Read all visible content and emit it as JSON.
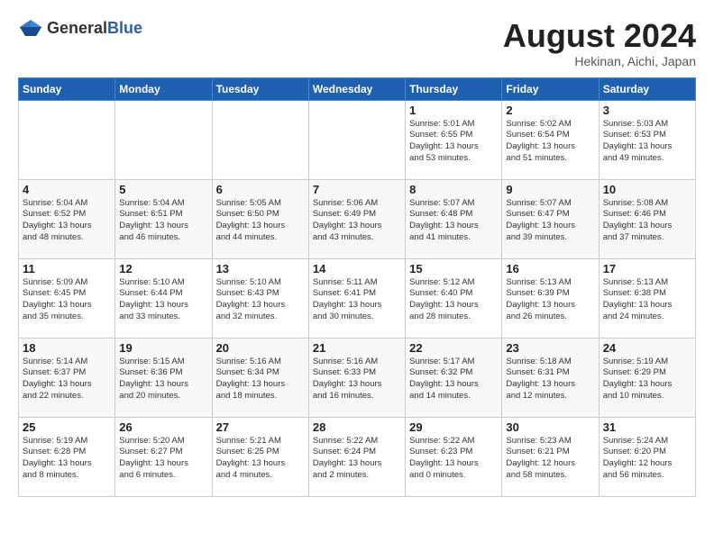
{
  "header": {
    "logo_general": "General",
    "logo_blue": "Blue",
    "month_year": "August 2024",
    "location": "Hekinan, Aichi, Japan"
  },
  "weekdays": [
    "Sunday",
    "Monday",
    "Tuesday",
    "Wednesday",
    "Thursday",
    "Friday",
    "Saturday"
  ],
  "weeks": [
    [
      {
        "day": "",
        "info": ""
      },
      {
        "day": "",
        "info": ""
      },
      {
        "day": "",
        "info": ""
      },
      {
        "day": "",
        "info": ""
      },
      {
        "day": "1",
        "info": "Sunrise: 5:01 AM\nSunset: 6:55 PM\nDaylight: 13 hours\nand 53 minutes."
      },
      {
        "day": "2",
        "info": "Sunrise: 5:02 AM\nSunset: 6:54 PM\nDaylight: 13 hours\nand 51 minutes."
      },
      {
        "day": "3",
        "info": "Sunrise: 5:03 AM\nSunset: 6:53 PM\nDaylight: 13 hours\nand 49 minutes."
      }
    ],
    [
      {
        "day": "4",
        "info": "Sunrise: 5:04 AM\nSunset: 6:52 PM\nDaylight: 13 hours\nand 48 minutes."
      },
      {
        "day": "5",
        "info": "Sunrise: 5:04 AM\nSunset: 6:51 PM\nDaylight: 13 hours\nand 46 minutes."
      },
      {
        "day": "6",
        "info": "Sunrise: 5:05 AM\nSunset: 6:50 PM\nDaylight: 13 hours\nand 44 minutes."
      },
      {
        "day": "7",
        "info": "Sunrise: 5:06 AM\nSunset: 6:49 PM\nDaylight: 13 hours\nand 43 minutes."
      },
      {
        "day": "8",
        "info": "Sunrise: 5:07 AM\nSunset: 6:48 PM\nDaylight: 13 hours\nand 41 minutes."
      },
      {
        "day": "9",
        "info": "Sunrise: 5:07 AM\nSunset: 6:47 PM\nDaylight: 13 hours\nand 39 minutes."
      },
      {
        "day": "10",
        "info": "Sunrise: 5:08 AM\nSunset: 6:46 PM\nDaylight: 13 hours\nand 37 minutes."
      }
    ],
    [
      {
        "day": "11",
        "info": "Sunrise: 5:09 AM\nSunset: 6:45 PM\nDaylight: 13 hours\nand 35 minutes."
      },
      {
        "day": "12",
        "info": "Sunrise: 5:10 AM\nSunset: 6:44 PM\nDaylight: 13 hours\nand 33 minutes."
      },
      {
        "day": "13",
        "info": "Sunrise: 5:10 AM\nSunset: 6:43 PM\nDaylight: 13 hours\nand 32 minutes."
      },
      {
        "day": "14",
        "info": "Sunrise: 5:11 AM\nSunset: 6:41 PM\nDaylight: 13 hours\nand 30 minutes."
      },
      {
        "day": "15",
        "info": "Sunrise: 5:12 AM\nSunset: 6:40 PM\nDaylight: 13 hours\nand 28 minutes."
      },
      {
        "day": "16",
        "info": "Sunrise: 5:13 AM\nSunset: 6:39 PM\nDaylight: 13 hours\nand 26 minutes."
      },
      {
        "day": "17",
        "info": "Sunrise: 5:13 AM\nSunset: 6:38 PM\nDaylight: 13 hours\nand 24 minutes."
      }
    ],
    [
      {
        "day": "18",
        "info": "Sunrise: 5:14 AM\nSunset: 6:37 PM\nDaylight: 13 hours\nand 22 minutes."
      },
      {
        "day": "19",
        "info": "Sunrise: 5:15 AM\nSunset: 6:36 PM\nDaylight: 13 hours\nand 20 minutes."
      },
      {
        "day": "20",
        "info": "Sunrise: 5:16 AM\nSunset: 6:34 PM\nDaylight: 13 hours\nand 18 minutes."
      },
      {
        "day": "21",
        "info": "Sunrise: 5:16 AM\nSunset: 6:33 PM\nDaylight: 13 hours\nand 16 minutes."
      },
      {
        "day": "22",
        "info": "Sunrise: 5:17 AM\nSunset: 6:32 PM\nDaylight: 13 hours\nand 14 minutes."
      },
      {
        "day": "23",
        "info": "Sunrise: 5:18 AM\nSunset: 6:31 PM\nDaylight: 13 hours\nand 12 minutes."
      },
      {
        "day": "24",
        "info": "Sunrise: 5:19 AM\nSunset: 6:29 PM\nDaylight: 13 hours\nand 10 minutes."
      }
    ],
    [
      {
        "day": "25",
        "info": "Sunrise: 5:19 AM\nSunset: 6:28 PM\nDaylight: 13 hours\nand 8 minutes."
      },
      {
        "day": "26",
        "info": "Sunrise: 5:20 AM\nSunset: 6:27 PM\nDaylight: 13 hours\nand 6 minutes."
      },
      {
        "day": "27",
        "info": "Sunrise: 5:21 AM\nSunset: 6:25 PM\nDaylight: 13 hours\nand 4 minutes."
      },
      {
        "day": "28",
        "info": "Sunrise: 5:22 AM\nSunset: 6:24 PM\nDaylight: 13 hours\nand 2 minutes."
      },
      {
        "day": "29",
        "info": "Sunrise: 5:22 AM\nSunset: 6:23 PM\nDaylight: 13 hours\nand 0 minutes."
      },
      {
        "day": "30",
        "info": "Sunrise: 5:23 AM\nSunset: 6:21 PM\nDaylight: 12 hours\nand 58 minutes."
      },
      {
        "day": "31",
        "info": "Sunrise: 5:24 AM\nSunset: 6:20 PM\nDaylight: 12 hours\nand 56 minutes."
      }
    ]
  ]
}
